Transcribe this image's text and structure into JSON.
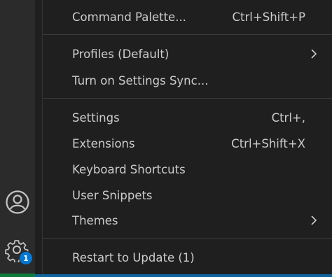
{
  "activity_bar": {
    "accounts_icon": "account-icon",
    "manage_icon": "gear-icon",
    "badge_count": "1"
  },
  "menu": {
    "items": [
      {
        "label": "Command Palette...",
        "shortcut": "Ctrl+Shift+P"
      },
      {
        "label": "Profiles (Default)",
        "submenu": true
      },
      {
        "label": "Turn on Settings Sync..."
      },
      {
        "label": "Settings",
        "shortcut": "Ctrl+,"
      },
      {
        "label": "Extensions",
        "shortcut": "Ctrl+Shift+X"
      },
      {
        "label": "Keyboard Shortcuts"
      },
      {
        "label": "User Snippets"
      },
      {
        "label": "Themes",
        "submenu": true
      },
      {
        "label": "Restart to Update (1)"
      }
    ]
  },
  "colors": {
    "menu_bg": "#1f1f1f",
    "text": "#cccccc",
    "separator": "#3c3c3c",
    "badge": "#0078d4"
  }
}
